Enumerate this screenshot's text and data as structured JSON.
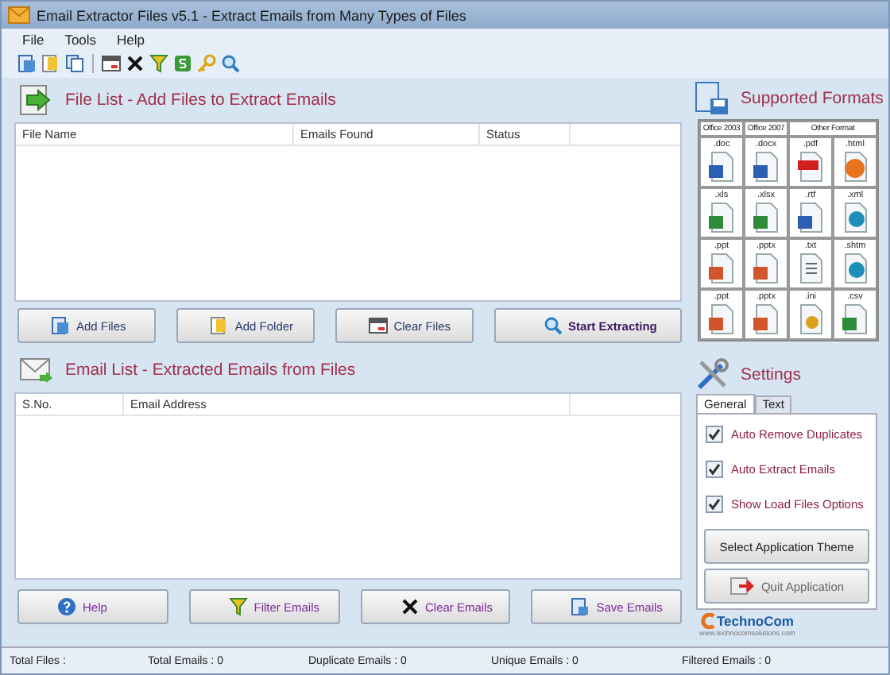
{
  "window": {
    "title": "Email Extractor Files v5.1 - Extract Emails from Many Types of Files"
  },
  "menu": [
    "File",
    "Tools",
    "Help"
  ],
  "file_list": {
    "title": "File List - Add Files to Extract Emails",
    "columns": [
      "File Name",
      "Emails Found",
      "Status"
    ]
  },
  "file_buttons": [
    {
      "label": "Add Files",
      "bold": false
    },
    {
      "label": "Add Folder",
      "bold": false
    },
    {
      "label": "Clear Files",
      "bold": false
    },
    {
      "label": "Start Extracting",
      "bold": true
    }
  ],
  "email_list": {
    "title": "Email List - Extracted Emails from Files",
    "columns": [
      "S.No.",
      "Email Address"
    ]
  },
  "email_buttons": [
    "Help",
    "Filter Emails",
    "Clear Emails",
    "Save Emails"
  ],
  "formats": {
    "title": "Supported Formats",
    "columns": [
      "Office 2003",
      "Office 2007",
      "Other Format"
    ],
    "rows": [
      [
        {
          "label": ".doc",
          "kind": "word"
        },
        {
          "label": ".docx",
          "kind": "word"
        },
        {
          "label": ".pdf",
          "kind": "pdf"
        },
        {
          "label": ".html",
          "kind": "browser"
        }
      ],
      [
        {
          "label": ".xls",
          "kind": "sheet"
        },
        {
          "label": ".xlsx",
          "kind": "sheet"
        },
        {
          "label": ".rtf",
          "kind": "word"
        },
        {
          "label": ".xml",
          "kind": "web"
        }
      ],
      [
        {
          "label": ".ppt",
          "kind": "slide"
        },
        {
          "label": ".pptx",
          "kind": "slide"
        },
        {
          "label": ".txt",
          "kind": "text"
        },
        {
          "label": ".shtm",
          "kind": "web"
        }
      ],
      [
        {
          "label": ".ppt",
          "kind": "slide"
        },
        {
          "label": ".pptx",
          "kind": "slide"
        },
        {
          "label": ".ini",
          "kind": "config"
        },
        {
          "label": ".csv",
          "kind": "sheet"
        }
      ]
    ]
  },
  "settings": {
    "title": "Settings",
    "tabs": [
      {
        "label": "General",
        "selected": true
      },
      {
        "label": "Text",
        "selected": false
      }
    ],
    "options": [
      {
        "label": "Auto Remove Duplicates",
        "checked": true
      },
      {
        "label": "Auto Extract Emails",
        "checked": true
      },
      {
        "label": "Show Load Files Options",
        "checked": true
      }
    ],
    "theme_button": "Select Application Theme",
    "quit_button": "Quit Application"
  },
  "logo": {
    "name": "TechnoCom",
    "url": "www.technocomsolutions.com"
  },
  "status_bar": [
    "Total Files :",
    "Total Emails : 0",
    "Duplicate Emails : 0",
    "Unique Emails : 0",
    "Filtered Emails : 0"
  ]
}
